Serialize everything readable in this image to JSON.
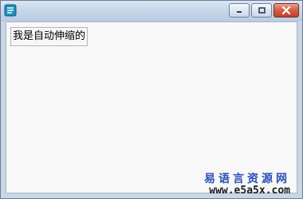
{
  "window": {
    "app_icon": "app-logo-icon",
    "controls": {
      "minimize_icon": "minimize-icon",
      "maximize_icon": "maximize-icon",
      "close_icon": "close-icon"
    },
    "accent_colors": {
      "close_button": "#c2412b",
      "title_bar": "#c7d6ea"
    }
  },
  "content": {
    "label_text": "我是自动伸缩的"
  },
  "watermark": {
    "site_name": "易语言资源网",
    "url": "www.e5a5x.com",
    "site_name_color": "#2a4fb6"
  }
}
